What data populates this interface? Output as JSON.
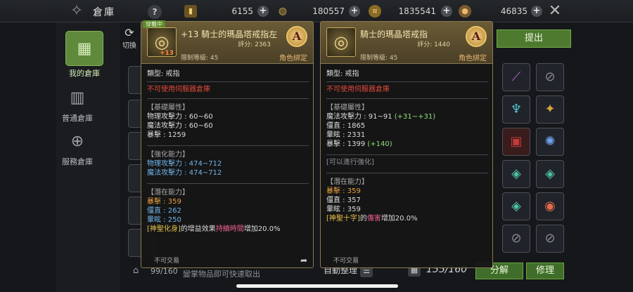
{
  "topbar": {
    "title": "倉庫",
    "help": "?",
    "currencies": [
      {
        "icon": "scroll-icon",
        "value": "6155"
      },
      {
        "icon": "coin-ring-icon",
        "value": "180557"
      },
      {
        "icon": "gold-coin-icon",
        "value": "1835541"
      },
      {
        "icon": "bronze-coin-icon",
        "value": "46835"
      }
    ]
  },
  "sidebar": {
    "items": [
      {
        "label": "我的倉庫",
        "icon": "box-icon",
        "active": true
      },
      {
        "label": "普通倉庫",
        "icon": "warehouse-icon",
        "active": false
      },
      {
        "label": "服務倉庫",
        "icon": "service-icon",
        "active": false
      }
    ],
    "switch_label": "切換"
  },
  "right_panel": {
    "extract_label": "提出"
  },
  "bottom": {
    "slots_left": "99/160",
    "hint": "變掌物品即可快速取出",
    "sort_label": "自動整理",
    "slots_right": "155/160",
    "decompose_label": "分解",
    "repair_label": "修理"
  },
  "tooltip_left": {
    "equip_tag": "穿戴中",
    "name": "+13 騎士的瑪晶塔戒指左",
    "plus_badge": "+13",
    "score": "評分: 2363",
    "grade": "A",
    "level_req": "限制等級: 45",
    "bind": "角色綁定",
    "type": "類型:   戒指",
    "restriction": "不可使用伺服器倉庫",
    "base_title": "【基礎屬性】",
    "base_stats": [
      "物理攻擊力 : 60~60",
      "魔法攻擊力 : 60~60",
      "暴擊 : 1259"
    ],
    "enh_title": "【強化能力】",
    "enh_stats": [
      "物理攻擊力 : 474~712",
      "魔法攻擊力 : 474~712"
    ],
    "pot_title": "【潛在能力】",
    "pot_stats": [
      "暴擊 : 359",
      "僵直 : 262",
      "暈眩 : 250"
    ],
    "effect_parts": [
      "[神聖化身]",
      "的增益效果",
      "持續時間",
      "增加20.0%"
    ],
    "untradeable": "不可交易"
  },
  "tooltip_right": {
    "name": "騎士的瑪晶塔戒指",
    "score": "評分: 1440",
    "grade": "A",
    "level_req": "限制等級: 45",
    "bind": "角色綁定",
    "type": "類型:   戒指",
    "restriction": "不可使用伺服器倉庫",
    "base_title": "【基礎屬性】",
    "base_stats": [
      {
        "text": "魔法攻擊力 : 91~91 ",
        "bonus": "(+31~+31)"
      },
      {
        "text": "僵直 : 1865",
        "bonus": ""
      },
      {
        "text": "暈眩 : 2331",
        "bonus": ""
      },
      {
        "text": "暴擊 : 1399 ",
        "bonus": "(+140)"
      }
    ],
    "enh_title": "[可以進行強化]",
    "pot_title": "【潛在能力】",
    "pot_stats": [
      "暴擊 : 359",
      "僵直 : 357",
      "暈眩 : 359"
    ],
    "effect_parts": [
      "[神聖十字]",
      "的",
      "傷害",
      "增加20.0%"
    ],
    "untradeable": "不可交易"
  }
}
